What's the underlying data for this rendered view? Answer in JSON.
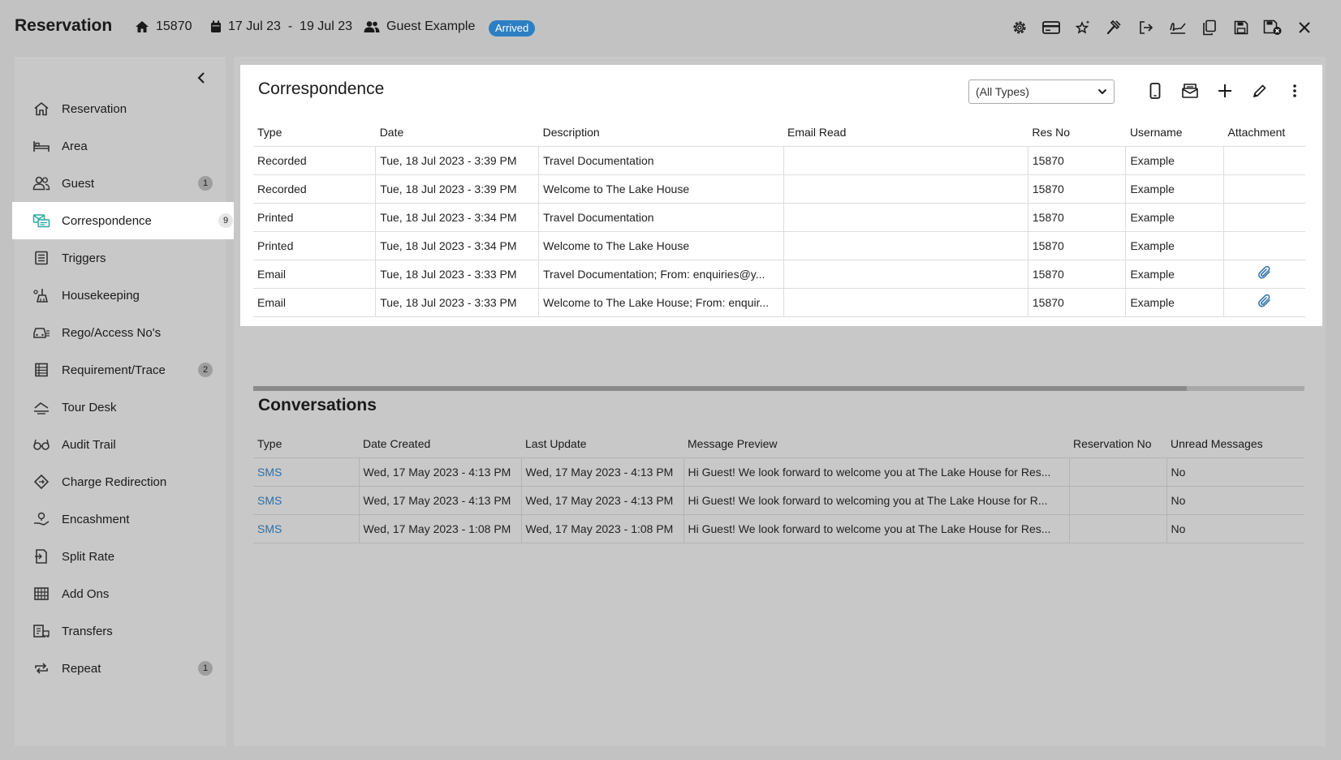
{
  "header": {
    "title": "Reservation",
    "res_no": "15870",
    "dates": "17 Jul 23  -  19 Jul 23",
    "guest": "Guest Example",
    "status": "Arrived",
    "status_color": "#2d7fc4",
    "tool_icons": [
      "settings-icon",
      "credit-card-icon",
      "stars-icon",
      "gavel-icon",
      "checkout-icon",
      "signature-icon",
      "copy-icon",
      "save-icon",
      "save-close-icon",
      "close-icon"
    ]
  },
  "sidebar": {
    "items": [
      {
        "label": "Reservation",
        "icon": "home-icon",
        "count": ""
      },
      {
        "label": "Area",
        "icon": "bed-icon",
        "count": ""
      },
      {
        "label": "Guest",
        "icon": "guests-icon",
        "count": "1"
      },
      {
        "label": "Correspondence",
        "icon": "correspondence-icon",
        "count": "9",
        "active": true
      },
      {
        "label": "Triggers",
        "icon": "triggers-icon",
        "count": ""
      },
      {
        "label": "Housekeeping",
        "icon": "housekeeping-icon",
        "count": ""
      },
      {
        "label": "Rego/Access No's",
        "icon": "car-icon",
        "count": ""
      },
      {
        "label": "Requirement/Trace",
        "icon": "list-icon",
        "count": "2"
      },
      {
        "label": "Tour Desk",
        "icon": "tour-icon",
        "count": ""
      },
      {
        "label": "Audit Trail",
        "icon": "glasses-icon",
        "count": ""
      },
      {
        "label": "Charge Redirection",
        "icon": "diamond-icon",
        "count": ""
      },
      {
        "label": "Encashment",
        "icon": "encash-icon",
        "count": ""
      },
      {
        "label": "Split Rate",
        "icon": "split-icon",
        "count": ""
      },
      {
        "label": "Add Ons",
        "icon": "grid-icon",
        "count": ""
      },
      {
        "label": "Transfers",
        "icon": "transfers-icon",
        "count": ""
      },
      {
        "label": "Repeat",
        "icon": "repeat-icon",
        "count": "1"
      }
    ]
  },
  "correspondence": {
    "title": "Correspondence",
    "filter_value": "(All Types)",
    "columns": [
      "Type",
      "Date",
      "Description",
      "Email Read",
      "Res No",
      "Username",
      "Attachment"
    ],
    "rows": [
      {
        "type": "Recorded",
        "date": "Tue, 18 Jul 2023 - 3:39 PM",
        "description": "Travel Documentation",
        "email_read": "",
        "res_no": "15870",
        "username": "Example",
        "attachment": false
      },
      {
        "type": "Recorded",
        "date": "Tue, 18 Jul 2023 - 3:39 PM",
        "description": "Welcome to The Lake House",
        "email_read": "",
        "res_no": "15870",
        "username": "Example",
        "attachment": false
      },
      {
        "type": "Printed",
        "date": "Tue, 18 Jul 2023 - 3:34 PM",
        "description": "Travel Documentation",
        "email_read": "",
        "res_no": "15870",
        "username": "Example",
        "attachment": false
      },
      {
        "type": "Printed",
        "date": "Tue, 18 Jul 2023 - 3:34 PM",
        "description": "Welcome to The Lake House",
        "email_read": "",
        "res_no": "15870",
        "username": "Example",
        "attachment": false
      },
      {
        "type": "Email",
        "date": "Tue, 18 Jul 2023 - 3:33 PM",
        "description": "Travel Documentation; From: enquiries@y...",
        "email_read": "",
        "res_no": "15870",
        "username": "Example",
        "attachment": true
      },
      {
        "type": "Email",
        "date": "Tue, 18 Jul 2023 - 3:33 PM",
        "description": "Welcome to The Lake House; From: enquir...",
        "email_read": "",
        "res_no": "15870",
        "username": "Example",
        "attachment": true
      }
    ]
  },
  "conversations": {
    "title": "Conversations",
    "columns": [
      "Type",
      "Date Created",
      "Last Update",
      "Message Preview",
      "Reservation No",
      "Unread Messages"
    ],
    "rows": [
      {
        "type": "SMS",
        "created": "Wed, 17 May 2023 - 4:13 PM",
        "updated": "Wed, 17 May 2023 - 4:13 PM",
        "preview": "Hi Guest! We look forward to welcome you at The Lake House for Res...",
        "res_no": "",
        "unread": "No"
      },
      {
        "type": "SMS",
        "created": "Wed, 17 May 2023 - 4:13 PM",
        "updated": "Wed, 17 May 2023 - 4:13 PM",
        "preview": "Hi Guest! We look forward to welcoming you at The Lake House for R...",
        "res_no": "",
        "unread": "No"
      },
      {
        "type": "SMS",
        "created": "Wed, 17 May 2023 - 1:08 PM",
        "updated": "Wed, 17 May 2023 - 1:08 PM",
        "preview": "Hi Guest! We look forward to welcome you at The Lake House for Res...",
        "res_no": "",
        "unread": "No"
      }
    ]
  }
}
